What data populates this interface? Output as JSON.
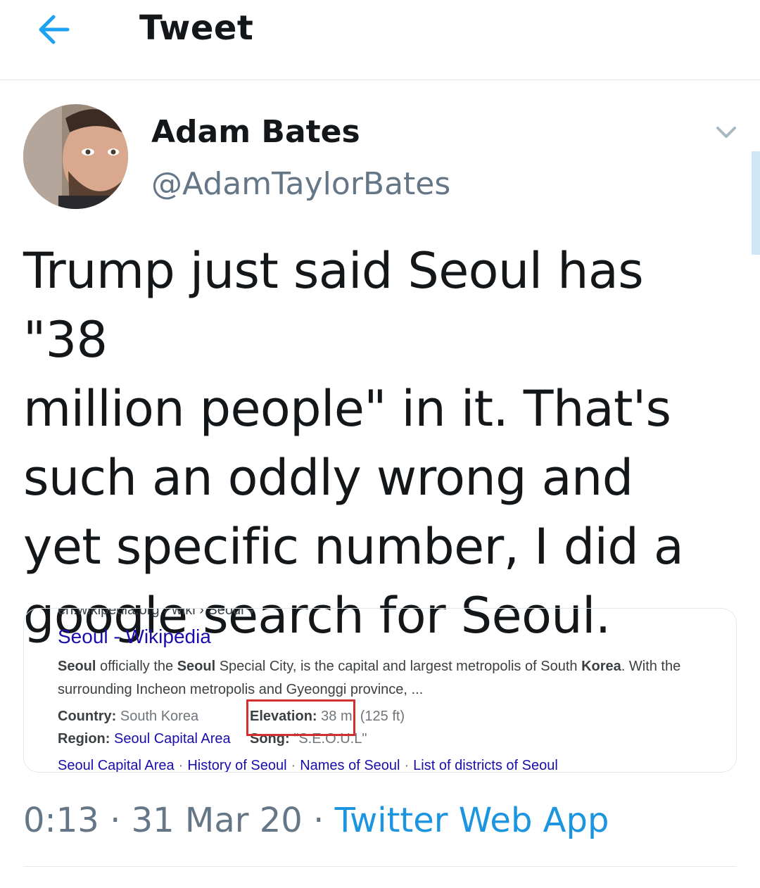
{
  "header": {
    "title": "Tweet",
    "back_icon": "arrow-left-icon",
    "accent": "#1da1f2"
  },
  "author": {
    "name": "Adam Bates",
    "handle": "@AdamTaylorBates",
    "avatar": "avatar-photo",
    "menu_icon": "chevron-down-icon"
  },
  "tweet": {
    "text": "Trump just said Seoul has \"38\nmillion people\" in it. That's\nsuch an oddly wrong and\nyet specific number, I did a\ngoogle search for Seoul."
  },
  "card": {
    "url": "en.wikipedia.org › wiki › Seoul",
    "url_arrow": "▾",
    "title": "Seoul - Wikipedia",
    "snippet_parts": [
      "Seoul",
      " officially the ",
      "Seoul",
      " Special City, is the capital and largest metropolis of South ",
      "Korea",
      ". With the surrounding Incheon metropolis and Gyeonggi province, ..."
    ],
    "facts": {
      "country_key": "Country",
      "country_val": "South Korea",
      "elevation_key": "Elevation",
      "elevation_val": "38 m",
      "elevation_extra": "(125 ft)",
      "region_key": "Region",
      "region_val": "Seoul Capital Area",
      "song_key": "Song",
      "song_val": "\"S.E.O.U.L\""
    },
    "links": [
      "Seoul Capital Area",
      "History of Seoul",
      "Names of Seoul",
      "List of districts of Seoul"
    ],
    "link_separator": "·",
    "highlight_color": "#d32f2f"
  },
  "meta": {
    "time": "0:13",
    "date": "31 Mar 20",
    "separator": "·",
    "source": "Twitter Web App"
  }
}
